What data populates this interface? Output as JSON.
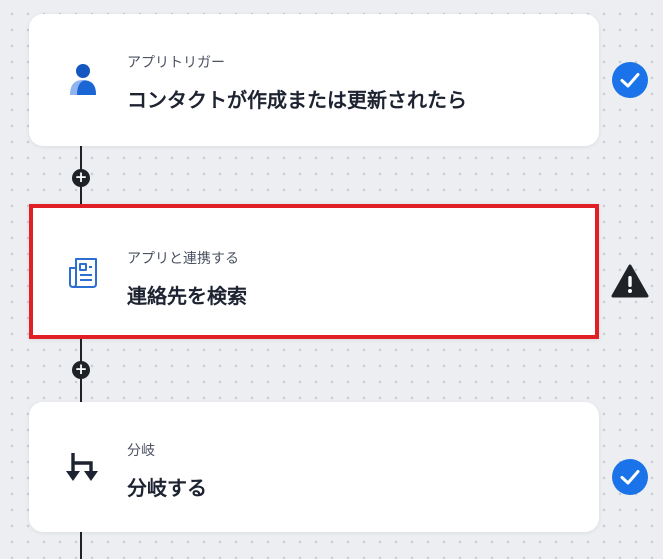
{
  "steps": [
    {
      "subtitle": "アプリトリガー",
      "title": "コンタクトが作成または更新されたら",
      "icon": "contact-person-icon",
      "status": "check"
    },
    {
      "subtitle": "アプリと連携する",
      "title": "連絡先を検索",
      "icon": "document-list-icon",
      "status": "warning"
    },
    {
      "subtitle": "分岐",
      "title": "分岐する",
      "icon": "branch-arrows-icon",
      "status": "check"
    }
  ],
  "add_step_symbol": "+",
  "colors": {
    "accent_blue": "#1a73e8",
    "selection_red": "#e01f26",
    "warning_dark": "#1f2328"
  }
}
